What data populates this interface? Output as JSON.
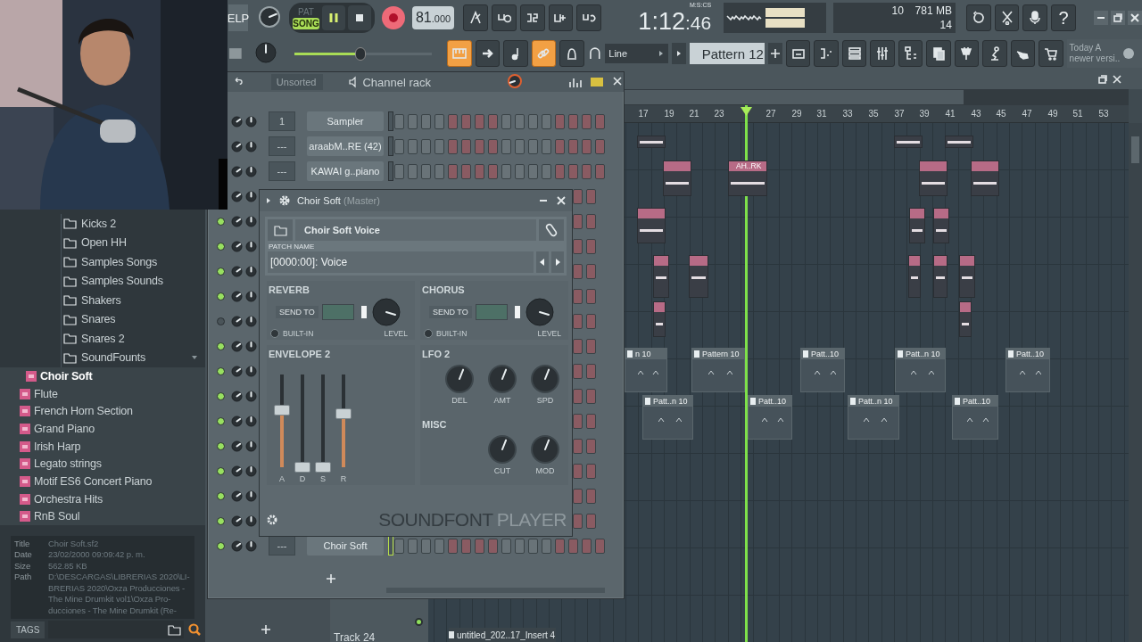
{
  "toolbar": {
    "help_label": "ELP",
    "transport_mode": [
      {
        "label": "PAT",
        "selected": false
      },
      {
        "label": "SONG",
        "selected": true
      }
    ],
    "tempo": {
      "whole": "81",
      "fraction": ".000"
    },
    "time": {
      "main": "1:12",
      "seconds": ":46",
      "unit": "M:S:CS"
    },
    "cpu": "10",
    "memory": "781 MB",
    "polyphony": "14",
    "help_button": "?",
    "master_volume": {
      "level": 0.48
    },
    "mode_buttons": [
      {
        "on": true
      },
      {
        "on": false
      },
      {
        "on": false
      },
      {
        "on": true
      },
      {
        "on": false
      }
    ],
    "snap": "Line",
    "pattern": "Pattern 12",
    "hint": [
      "Today  A",
      "newer versi.."
    ]
  },
  "browser": {
    "items": [
      {
        "label": "Kicks 2",
        "selected": false,
        "expanded": false
      },
      {
        "label": "Open HH",
        "selected": false,
        "expanded": false
      },
      {
        "label": "Samples Songs",
        "selected": false,
        "expanded": false
      },
      {
        "label": "Samples Sounds",
        "selected": false,
        "expanded": false
      },
      {
        "label": "Shakers",
        "selected": false,
        "expanded": false
      },
      {
        "label": "Snares",
        "selected": false,
        "expanded": false
      },
      {
        "label": "Snares 2",
        "selected": false,
        "expanded": false
      },
      {
        "label": "SoundFounts",
        "selected": false,
        "expanded": true,
        "children": [
          {
            "label": "Choir Soft",
            "selected": true
          },
          {
            "label": "Flute",
            "selected": false
          },
          {
            "label": "French Horn Section",
            "selected": false
          },
          {
            "label": "Grand Piano",
            "selected": false
          },
          {
            "label": "Irish Harp",
            "selected": false
          },
          {
            "label": "Legato strings",
            "selected": false
          },
          {
            "label": "Motif ES6 Concert Piano",
            "selected": false
          },
          {
            "label": "Orchestra Hits",
            "selected": false
          },
          {
            "label": "RnB Soul",
            "selected": false
          }
        ]
      }
    ],
    "info": [
      {
        "key": "Title",
        "value": "Choir Soft.sf2"
      },
      {
        "key": "Date",
        "value": "23/02/2000 09:09:42 p. m."
      },
      {
        "key": "Size",
        "value": "562.85 KB"
      },
      {
        "key": "Path",
        "value": "D:\\DESCARGAS\\LIBRERIAS 2020\\LI-BRERIAS 2020\\Oxza Producciones - The Mine Drumkit vol1\\Oxza Pro-ducciones - The Mine Drumkit (Re-"
      }
    ],
    "tags_label": "TAGS"
  },
  "channel_rack": {
    "filter": "Unsorted",
    "title": "Channel rack",
    "channels": [
      {
        "kind": "named",
        "name": "Sampler",
        "number": "1",
        "selected": false
      },
      {
        "kind": "named",
        "name": "araabM..RE (42)",
        "number": "---",
        "selected": false
      },
      {
        "kind": "named",
        "name": "KAWAI g..piano",
        "number": "---",
        "selected": false
      },
      {
        "kind": "covered"
      },
      {
        "kind": "covered",
        "led_on": true
      },
      {
        "kind": "covered",
        "led_on": true
      },
      {
        "kind": "covered",
        "led_on": true
      },
      {
        "kind": "covered",
        "led_on": true
      },
      {
        "kind": "covered",
        "led_on": false
      },
      {
        "kind": "covered",
        "led_on": true
      },
      {
        "kind": "covered",
        "led_on": true
      },
      {
        "kind": "covered",
        "led_on": true
      },
      {
        "kind": "covered",
        "led_on": true
      },
      {
        "kind": "covered",
        "led_on": true
      },
      {
        "kind": "covered",
        "led_on": true
      },
      {
        "kind": "covered",
        "led_on": true
      },
      {
        "kind": "covered",
        "led_on": true
      },
      {
        "kind": "named",
        "name": "Choir Soft",
        "number": "---",
        "selected": true,
        "led_on": true
      }
    ]
  },
  "plugin": {
    "title": "Choir Soft",
    "subtitle": "(Master)",
    "preset": "Choir Soft Voice",
    "patch_label": "PATCH NAME",
    "patch": "[0000:00]: Voice",
    "effects": [
      {
        "title": "REVERB",
        "send_label": "SEND TO",
        "builtin_label": "BUILT-IN",
        "builtin": false,
        "level_label": "LEVEL"
      },
      {
        "title": "CHORUS",
        "send_label": "SEND TO",
        "builtin_label": "BUILT-IN",
        "builtin": false,
        "level_label": "LEVEL"
      }
    ],
    "envelope": {
      "title": "ENVELOPE 2",
      "sliders": [
        {
          "label": "A",
          "level": 0.62
        },
        {
          "label": "D",
          "level": 0.0
        },
        {
          "label": "S",
          "level": 0.0
        },
        {
          "label": "R",
          "level": 0.58
        }
      ]
    },
    "lfo": {
      "title": "LFO 2",
      "knobs": [
        {
          "label": "DEL"
        },
        {
          "label": "AMT"
        },
        {
          "label": "SPD"
        }
      ]
    },
    "misc": {
      "title": "MISC",
      "knobs": [
        {
          "label": "CUT"
        },
        {
          "label": "MOD"
        }
      ]
    },
    "brand": [
      "SOUNDFONT",
      "PLAYER"
    ]
  },
  "playlist": {
    "ruler": [
      "17",
      "19",
      "21",
      "23",
      "27",
      "29",
      "31",
      "33",
      "35",
      "37",
      "39",
      "41",
      "43",
      "45",
      "47",
      "49",
      "51",
      "53"
    ],
    "clips": [
      {
        "kind": "audio"
      },
      {
        "kind": "audio"
      },
      {
        "kind": "audio"
      },
      {
        "kind": "audio"
      },
      {
        "kind": "audio",
        "label": "AH..RK"
      },
      {
        "kind": "audio"
      },
      {
        "kind": "audio"
      },
      {
        "kind": "audio"
      },
      {
        "kind": "audio"
      },
      {
        "kind": "audio"
      },
      {
        "kind": "audio"
      },
      {
        "kind": "audio"
      },
      {
        "kind": "audio"
      },
      {
        "kind": "audio"
      },
      {
        "kind": "audio"
      },
      {
        "kind": "audio"
      },
      {
        "kind": "audio"
      },
      {
        "kind": "pattern",
        "label": "n 10"
      },
      {
        "kind": "pattern",
        "label": "Pattern 10"
      },
      {
        "kind": "pattern",
        "label": "Patt..10"
      },
      {
        "kind": "pattern",
        "label": "Patt..n 10"
      },
      {
        "kind": "pattern",
        "label": "Patt..10"
      },
      {
        "kind": "pattern",
        "label": "Patt..n 10"
      },
      {
        "kind": "pattern",
        "label": "Patt..10"
      },
      {
        "kind": "pattern",
        "label": "Patt..n 10"
      },
      {
        "kind": "pattern",
        "label": "Patt..10"
      },
      {
        "kind": "audio_strip",
        "label": "untitled_202..17_Insert 4"
      }
    ],
    "track_label": "Track 24"
  }
}
